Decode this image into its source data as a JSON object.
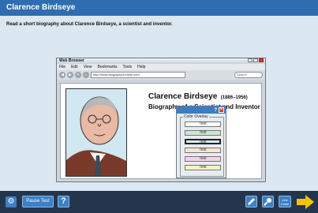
{
  "header": {
    "title": "Clarence Birdseye"
  },
  "instruction": "Read a short biography about Clarence Birdseye, a scientist and inventor.",
  "browser": {
    "window_title": "Web Browser",
    "menu": [
      "File",
      "Edit",
      "View",
      "Bookmarks",
      "Tools",
      "Help"
    ],
    "url": "http://www.biography4online.com",
    "search_placeholder": "Search"
  },
  "page": {
    "name": "Clarence Birdseye",
    "years": "(1886–1956)",
    "subtitle": "Biography of a Scientist and Inventor"
  },
  "overlay": {
    "help": "?",
    "close": "✕",
    "label": "Color Overlay",
    "swatches": [
      {
        "label": "Text",
        "color": "#ffffff"
      },
      {
        "label": "Text",
        "color": "#cfe6cf"
      },
      {
        "label": "Text",
        "color": "#dbe9f5"
      },
      {
        "label": "Text",
        "color": "#f5e6cf"
      },
      {
        "label": "Text",
        "color": "#f3d3ea"
      },
      {
        "label": "Text",
        "color": "#f5f2c6"
      }
    ]
  },
  "footer": {
    "settings_icon": "⚙",
    "pause_label": "Pause Test",
    "help_label": "?",
    "line_guide_label": "Line Guide",
    "accent": "#3b80c8",
    "next_color": "#f2c400"
  }
}
